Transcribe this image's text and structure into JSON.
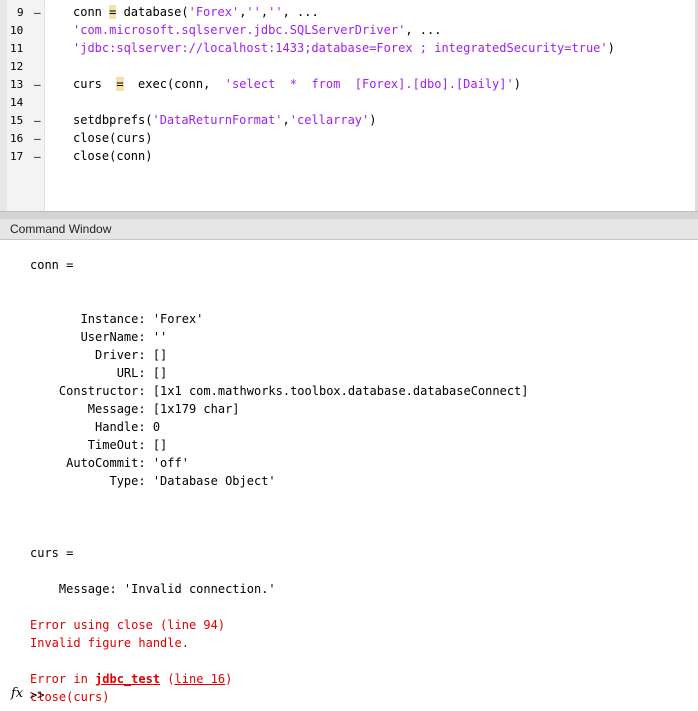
{
  "editor": {
    "lines": [
      {
        "num": "9",
        "bp": "–",
        "code": [
          {
            "t": "conn "
          },
          {
            "t": "=",
            "hl": true
          },
          {
            "t": " database("
          },
          {
            "t": "'Forex'",
            "s": true
          },
          {
            "t": ","
          },
          {
            "t": "''",
            "s": true
          },
          {
            "t": ","
          },
          {
            "t": "''",
            "s": true
          },
          {
            "t": ", ..."
          }
        ]
      },
      {
        "num": "10",
        "bp": "",
        "code": [
          {
            "t": "'com.microsoft.sqlserver.jdbc.SQLServerDriver'",
            "s": true
          },
          {
            "t": ", ..."
          }
        ]
      },
      {
        "num": "11",
        "bp": "",
        "code": [
          {
            "t": "'jdbc:sqlserver://localhost:1433;database=Forex ; integratedSecurity=true'",
            "s": true
          },
          {
            "t": ")"
          }
        ]
      },
      {
        "num": "12",
        "bp": "",
        "code": []
      },
      {
        "num": "13",
        "bp": "–",
        "code": [
          {
            "t": "curs  "
          },
          {
            "t": "=",
            "hl": true
          },
          {
            "t": "  exec(conn,  "
          },
          {
            "t": "'select  *  from  [Forex].[dbo].[Daily]'",
            "s": true
          },
          {
            "t": ")"
          }
        ]
      },
      {
        "num": "14",
        "bp": "",
        "code": []
      },
      {
        "num": "15",
        "bp": "–",
        "code": [
          {
            "t": "setdbprefs("
          },
          {
            "t": "'DataReturnFormat'",
            "s": true
          },
          {
            "t": ","
          },
          {
            "t": "'cellarray'",
            "s": true
          },
          {
            "t": ")"
          }
        ]
      },
      {
        "num": "16",
        "bp": "–",
        "code": [
          {
            "t": "close(curs)"
          }
        ]
      },
      {
        "num": "17",
        "bp": "–",
        "code": [
          {
            "t": "close(conn)"
          }
        ]
      }
    ]
  },
  "command_window": {
    "title": "Command Window",
    "output": [
      {
        "text": "conn ="
      },
      {
        "text": ""
      },
      {
        "text": ""
      },
      {
        "text": "       Instance: 'Forex'"
      },
      {
        "text": "       UserName: ''"
      },
      {
        "text": "         Driver: []"
      },
      {
        "text": "            URL: []"
      },
      {
        "text": "    Constructor: [1x1 com.mathworks.toolbox.database.databaseConnect]"
      },
      {
        "text": "        Message: [1x179 char]"
      },
      {
        "text": "         Handle: 0"
      },
      {
        "text": "        TimeOut: []"
      },
      {
        "text": "     AutoCommit: 'off'"
      },
      {
        "text": "           Type: 'Database Object'"
      },
      {
        "text": ""
      },
      {
        "text": ""
      },
      {
        "text": ""
      },
      {
        "text": "curs ="
      },
      {
        "text": ""
      },
      {
        "text": "    Message: 'Invalid connection.'"
      },
      {
        "text": ""
      },
      {
        "text": "Error using close (line 94)",
        "err": true
      },
      {
        "text": "Invalid figure handle.",
        "err": true
      },
      {
        "text": ""
      },
      {
        "err_in": true,
        "prefix": "Error in ",
        "func": "jdbc_test",
        "mid": " (",
        "line": "line 16",
        "suffix": ")"
      },
      {
        "text": "close(curs)",
        "err": true
      }
    ],
    "prompt_symbol": "fx",
    "prompt": ">>"
  }
}
